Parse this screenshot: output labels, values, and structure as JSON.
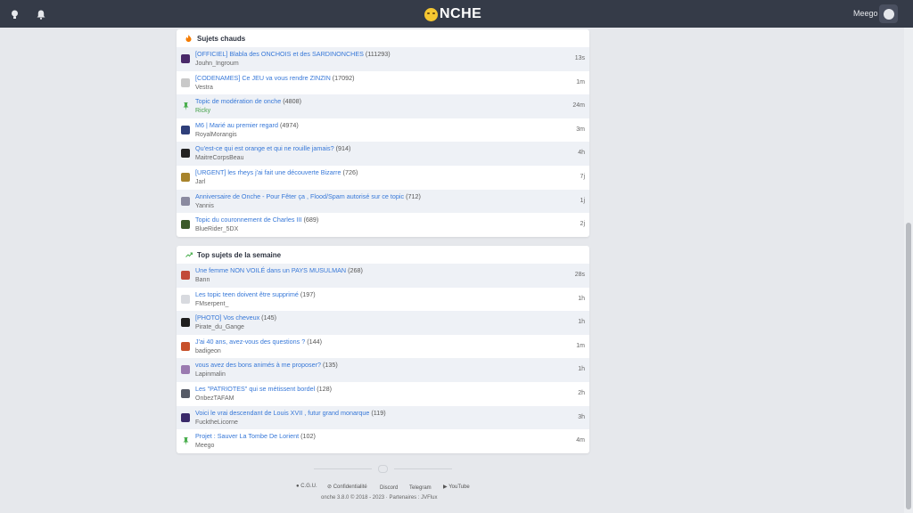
{
  "header": {
    "logo_text": "NCHE",
    "user_name": "Meego"
  },
  "hot": {
    "title": "Sujets chauds",
    "rows": [
      {
        "title": "[OFFICIEL] Blabla des ONCHOIS et des SARDINONCHES",
        "count": "(111293)",
        "author": "Jouhn_Ingroum",
        "time": "13s",
        "avatar": "#4a2a6a"
      },
      {
        "title": "[CODENAMES] Ce JEU va vous rendre ZINZIN",
        "count": "(17092)",
        "author": "Vestra",
        "time": "1m",
        "avatar": "#c9c9c9"
      },
      {
        "title": "Topic de modération de onche",
        "count": "(4808)",
        "author": "Ricky",
        "time": "24m",
        "avatar": "pin",
        "green": true
      },
      {
        "title": "M6 | Marié au premier regard",
        "count": "(4974)",
        "author": "RoyalMorangis",
        "time": "3m",
        "avatar": "#2f3f7a"
      },
      {
        "title": "Qu'est-ce qui est orange et qui ne rouille jamais?",
        "count": "(914)",
        "author": "MaitreCorpsBeau",
        "time": "4h",
        "avatar": "#222222"
      },
      {
        "title": "[URGENT] les rheys j'ai fait une découverte Bizarre",
        "count": "(726)",
        "author": "Jarl",
        "time": "7j",
        "avatar": "#a8842c"
      },
      {
        "title": "Anniversaire de Onche - Pour Fêter ça , Flood/Spam autorisé sur ce topic",
        "count": "(712)",
        "author": "Yannis",
        "time": "1j",
        "avatar": "#8a8aa0"
      },
      {
        "title": "Topic du couronnement de Charles III",
        "count": "(689)",
        "author": "BlueRider_5DX",
        "time": "2j",
        "avatar": "#3c5a2a"
      }
    ]
  },
  "week": {
    "title": "Top sujets de la semaine",
    "rows": [
      {
        "title": "Une femme NON VOILÉ dans un PAYS MUSULMAN",
        "count": "(268)",
        "author": "Bann",
        "time": "28s",
        "avatar": "#c24a3a"
      },
      {
        "title": "Les topic teen doivent être supprimé",
        "count": "(197)",
        "author": "FMserpent_",
        "time": "1h",
        "avatar": "#d8dadf"
      },
      {
        "title": "[PHOTO] Vos cheveux",
        "count": "(145)",
        "author": "Pirate_du_Gange",
        "time": "1h",
        "avatar": "#1e1e1e"
      },
      {
        "title": "J'ai 40 ans, avez-vous des questions ?",
        "count": "(144)",
        "author": "badigeon",
        "time": "1m",
        "avatar": "#c7502a"
      },
      {
        "title": "vous avez des bons animés à me proposer?",
        "count": "(135)",
        "author": "Lapinmalin",
        "time": "1h",
        "avatar": "#9a7ab0"
      },
      {
        "title": "Les \"PATRIOTES\" qui se métissent bordel",
        "count": "(128)",
        "author": "OnbezTAFAM",
        "time": "2h",
        "avatar": "#555a66"
      },
      {
        "title": "Voici le vrai descendant de Louis XVII , futur grand monarque",
        "count": "(119)",
        "author": "FucktheLicorne",
        "time": "3h",
        "avatar": "#3a2a6a"
      },
      {
        "title": "Projet : Sauver La Tombe De Lorient",
        "count": "(102)",
        "author": "Meego",
        "time": "4m",
        "avatar": "pin"
      }
    ]
  },
  "footer": {
    "cgu": "C.G.U.",
    "confid": "Confidentialité",
    "discord": "Discord",
    "telegram": "Telegram",
    "youtube": "YouTube",
    "copyright": "onche 3.8.0 © 2018 - 2023 · Partenaires : JVFlux"
  },
  "colors": {
    "navbar": "#353b48",
    "link": "#3778d8",
    "pin": "#4caf50"
  }
}
